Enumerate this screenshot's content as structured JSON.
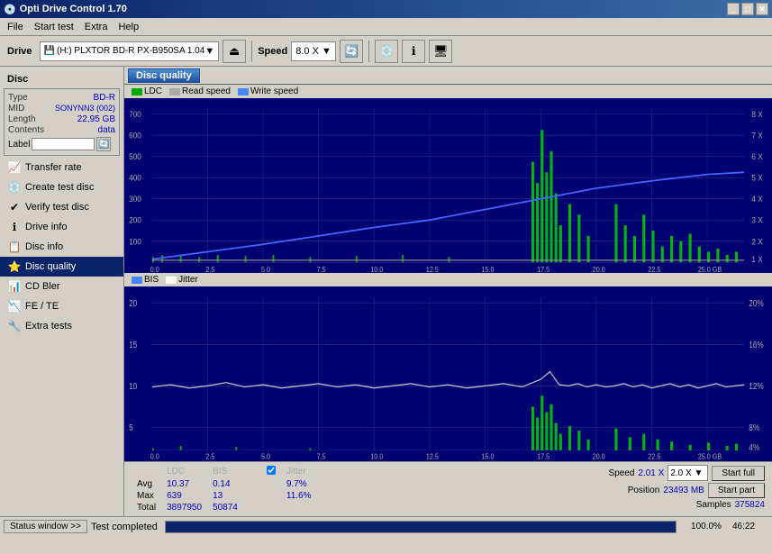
{
  "app": {
    "title": "Opti Drive Control 1.70",
    "title_icon": "disc-icon"
  },
  "title_buttons": {
    "minimize": "_",
    "maximize": "□",
    "close": "✕"
  },
  "menu": {
    "items": [
      "File",
      "Start test",
      "Extra",
      "Help"
    ]
  },
  "toolbar": {
    "drive_label": "Drive",
    "drive_icon": "hd-icon",
    "drive_value": "(H:)  PLXTOR BD-R  PX-B950SA 1.04",
    "speed_label": "Speed",
    "speed_value": "8.0 X ▼",
    "buttons": [
      "eject-icon",
      "refresh-icon",
      "blank-icon",
      "info-icon",
      "window-icon"
    ]
  },
  "sidebar": {
    "disc_section_label": "Disc",
    "disc_info": {
      "type_label": "Type",
      "type_value": "BD-R",
      "mid_label": "MID",
      "mid_value": "SONYNN3 (002)",
      "length_label": "Length",
      "length_value": "22,95 GB",
      "contents_label": "Contents",
      "contents_value": "data",
      "label_label": "Label",
      "label_placeholder": ""
    },
    "nav_items": [
      {
        "id": "transfer-rate",
        "label": "Transfer rate",
        "icon": "📈"
      },
      {
        "id": "create-test-disc",
        "label": "Create test disc",
        "icon": "💿"
      },
      {
        "id": "verify-test-disc",
        "label": "Verify test disc",
        "icon": "✔"
      },
      {
        "id": "drive-info",
        "label": "Drive info",
        "icon": "ℹ"
      },
      {
        "id": "disc-info",
        "label": "Disc info",
        "icon": "📋"
      },
      {
        "id": "disc-quality",
        "label": "Disc quality",
        "icon": "⭐",
        "active": true
      },
      {
        "id": "cd-bler",
        "label": "CD Bler",
        "icon": "📊"
      },
      {
        "id": "fe-te",
        "label": "FE / TE",
        "icon": "📉"
      },
      {
        "id": "extra-tests",
        "label": "Extra tests",
        "icon": "🔧"
      }
    ]
  },
  "content": {
    "title": "Disc quality",
    "top_chart": {
      "legend": [
        {
          "label": "LDC",
          "color": "#00aa00"
        },
        {
          "label": "Read speed",
          "color": "#ffffff"
        },
        {
          "label": "Write speed",
          "color": "#4488ff"
        }
      ],
      "y_max": 700,
      "y_labels": [
        "700",
        "600",
        "500",
        "400",
        "300",
        "200",
        "100"
      ],
      "x_labels": [
        "0.0",
        "2.5",
        "5.0",
        "7.5",
        "10.0",
        "12.5",
        "15.0",
        "17.5",
        "20.0",
        "22.5",
        "25.0 GB"
      ],
      "y_right_labels": [
        "8X",
        "7X",
        "6X",
        "5X",
        "4X",
        "3X",
        "2X",
        "1X"
      ]
    },
    "bottom_chart": {
      "legend": [
        {
          "label": "BIS",
          "color": "#4488ff"
        },
        {
          "label": "Jitter",
          "color": "#ffffff"
        }
      ],
      "y_max": 20,
      "y_labels": [
        "20",
        "15",
        "10",
        "5"
      ],
      "x_labels": [
        "0.0",
        "2.5",
        "5.0",
        "7.5",
        "10.0",
        "12.5",
        "15.0",
        "17.5",
        "20.0",
        "22.5",
        "25.0 GB"
      ],
      "y_right_labels": [
        "20%",
        "16%",
        "12%",
        "8%",
        "4%"
      ]
    }
  },
  "stats": {
    "headers": [
      "",
      "LDC",
      "BIS",
      "",
      "Jitter"
    ],
    "avg_label": "Avg",
    "avg_ldc": "10.37",
    "avg_bis": "0.14",
    "avg_jitter": "9.7%",
    "max_label": "Max",
    "max_ldc": "639",
    "max_bis": "13",
    "max_jitter": "11.6%",
    "total_label": "Total",
    "total_ldc": "3897950",
    "total_bis": "50874",
    "jitter_checkbox": true,
    "speed_label": "Speed",
    "speed_value": "2.01 X",
    "speed_select": "2.0 X ▼",
    "position_label": "Position",
    "position_value": "23493 MB",
    "samples_label": "Samples",
    "samples_value": "375824",
    "start_full_btn": "Start full",
    "start_part_btn": "Start part"
  },
  "status_bar": {
    "status_window_btn": "Status window >>",
    "status_text": "Test completed",
    "progress_percent": "100.0%",
    "time": "46:22"
  }
}
